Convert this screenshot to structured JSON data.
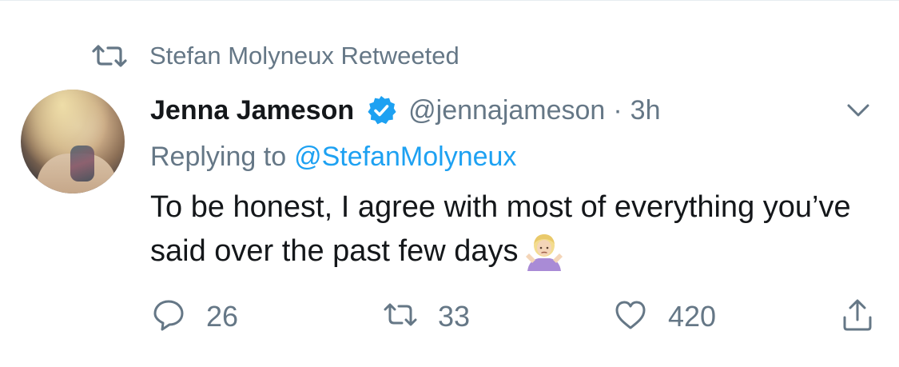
{
  "retweet_context": {
    "icon": "retweet-icon",
    "text": "Stefan Molyneux Retweeted"
  },
  "tweet": {
    "author": {
      "display_name": "Jenna Jameson",
      "handle": "@jennajameson",
      "verified": true,
      "avatar": "profile-photo"
    },
    "separator": "·",
    "time": "3h",
    "menu_icon": "chevron-down-icon",
    "reply_prefix": "Replying to",
    "reply_to": "@StefanMolyneux",
    "text": "To be honest, I agree with most of everything you’ve said over the past few days",
    "emoji": "woman-shrugging-emoji"
  },
  "actions": {
    "replies": {
      "icon": "reply-icon",
      "count": "26"
    },
    "retweets": {
      "icon": "retweet-icon",
      "count": "33"
    },
    "likes": {
      "icon": "heart-icon",
      "count": "420"
    },
    "share": {
      "icon": "share-icon"
    }
  },
  "colors": {
    "text_primary": "#14171a",
    "text_secondary": "#657786",
    "link": "#1da1f2",
    "verified": "#1da1f2"
  }
}
